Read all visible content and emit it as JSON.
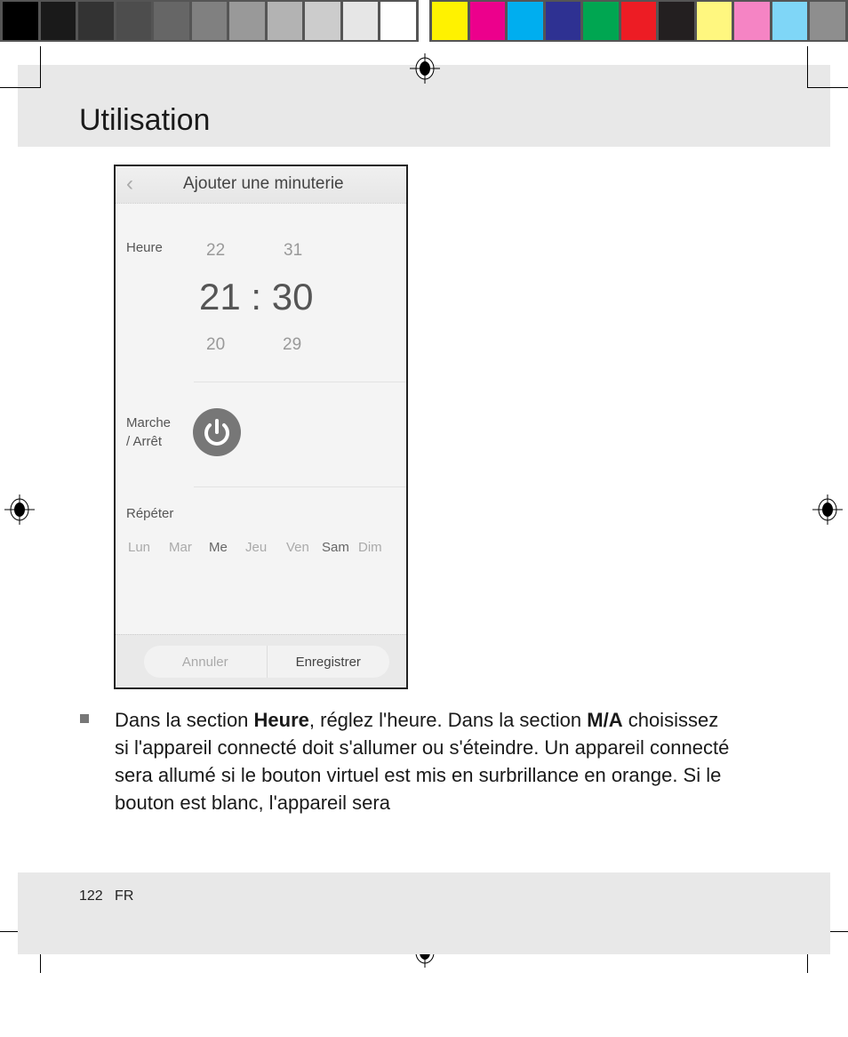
{
  "colors": {
    "grays": [
      "#000000",
      "#1a1a1a",
      "#333333",
      "#4d4d4d",
      "#666666",
      "#808080",
      "#999999",
      "#b3b3b3",
      "#cccccc",
      "#e6e6e6",
      "#ffffff"
    ],
    "process": [
      "#fff200",
      "#ec008c",
      "#00aeef",
      "#2e3192",
      "#00a651",
      "#ed1c24",
      "#231f20",
      "#fff77f",
      "#f584c4",
      "#7fd6f7",
      "#8e8e8e"
    ]
  },
  "header": {
    "title": "Utilisation"
  },
  "phone": {
    "title": "Ajouter une minuterie",
    "hour_label": "Heure",
    "hour_above": "22",
    "minute_above": "31",
    "time": "21 : 30",
    "hour_below": "20",
    "minute_below": "29",
    "onoff_label_1": "Marche",
    "onoff_label_2": "/ Arrêt",
    "repeat_label": "Répéter",
    "days": [
      "Lun",
      "Mar",
      "Me",
      "Jeu",
      "Ven",
      "Sam",
      "Dim"
    ],
    "cancel": "Annuler",
    "save": "Enregistrer"
  },
  "body": {
    "t1": "Dans la section ",
    "b1": "Heure",
    "t2": ", réglez l'heure. Dans la section ",
    "b2": "M/A",
    "t3": " choisissez si l'appareil connecté doit s'allumer ou s'éteindre. Un appareil connecté sera allumé si le bouton virtuel est mis en surbrillance en orange. Si le bouton est blanc, l'appareil sera"
  },
  "footer": {
    "page": "122",
    "lang": "FR"
  }
}
